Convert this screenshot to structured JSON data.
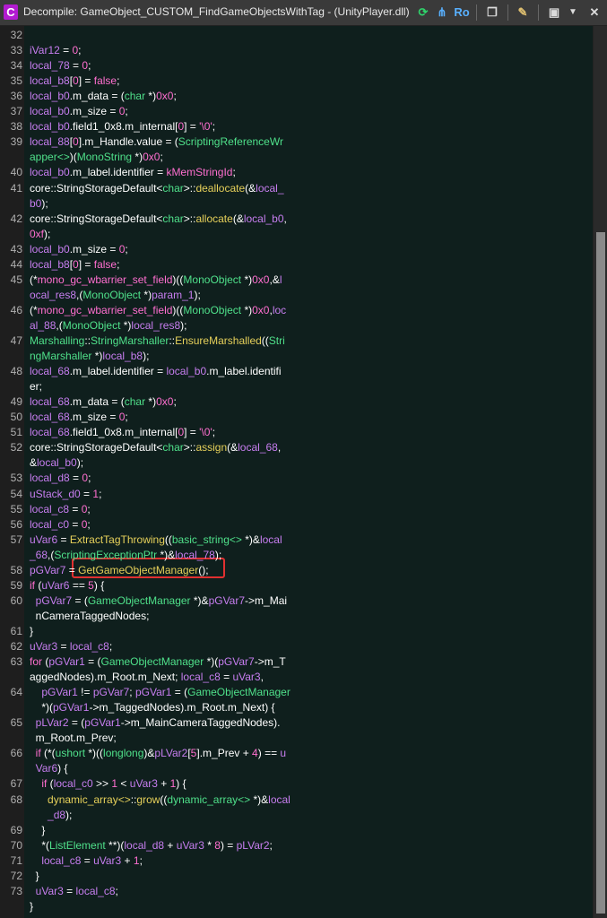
{
  "window": {
    "title": "Decompile: GameObject_CUSTOM_FindGameObjectsWithTag -  (UnityPlayer.dll)",
    "app_icon_letter": "C",
    "toolbar": {
      "refresh_icon": "refresh-icon",
      "graph_icon": "graph-icon",
      "ro_label": "Ro",
      "copy_icon": "copy-icon",
      "edit_icon": "edit-icon",
      "snapshot_icon": "snapshot-icon",
      "close_label": "✕"
    }
  },
  "gutter_numbers": [
    "32",
    "33",
    "34",
    "35",
    "36",
    "37",
    "38",
    "39",
    "40",
    "41",
    "42",
    "43",
    "44",
    "45",
    "46",
    "47",
    "48",
    "49",
    "50",
    "51",
    "52",
    "53",
    "54",
    "55",
    "56",
    "57",
    "58",
    "59",
    "60",
    "61",
    "62",
    "63",
    "64",
    "65",
    "66",
    "67",
    "68",
    "69",
    "70",
    "71",
    "72",
    "73"
  ],
  "highlight": {
    "text": "GetGameObjectManager();",
    "color": "#e03030"
  },
  "code_lines": [
    {
      "ln": "32",
      "html": ""
    },
    {
      "ln": "33",
      "html": "<span class='v'>iVar12</span> = <span class='n'>0</span>;"
    },
    {
      "ln": "34",
      "html": "<span class='v'>local_78</span> = <span class='n'>0</span>;"
    },
    {
      "ln": "35",
      "html": "<span class='v'>local_b8</span>[<span class='n'>0</span>] = <span class='n'>false</span>;"
    },
    {
      "ln": "36",
      "html": "<span class='v'>local_b0</span>.m_data = (<span class='t'>char</span> *)<span class='n'>0x0</span>;"
    },
    {
      "ln": "37",
      "html": "<span class='v'>local_b0</span>.m_size = <span class='n'>0</span>;"
    },
    {
      "ln": "38",
      "html": "<span class='v'>local_b0</span>.field1_0x8.m_internal[<span class='n'>0</span>] = <span class='n'>'\\0'</span>;"
    },
    {
      "ln": "39",
      "html": "<span class='v'>local_88</span>[<span class='n'>0</span>].m_Handle.value = (<span class='t'>ScriptingReferenceWr</span>"
    },
    {
      "ln": "",
      "html": "<span class='t'>apper&lt;&gt;</span>)(<span class='t'>MonoString</span> *)<span class='n'>0x0</span>;"
    },
    {
      "ln": "40",
      "html": "<span class='v'>local_b0</span>.m_label.identifier = <span class='n'>kMemStringId</span>;"
    },
    {
      "ln": "41",
      "html": "core::StringStorageDefault&lt;<span class='t'>char</span>&gt;::<span class='f'>deallocate</span>(&amp;<span class='v'>local_</span>"
    },
    {
      "ln": "",
      "html": "<span class='v'>b0</span>);"
    },
    {
      "ln": "42",
      "html": "core::StringStorageDefault&lt;<span class='t'>char</span>&gt;::<span class='f'>allocate</span>(&amp;<span class='v'>local_b0</span>,"
    },
    {
      "ln": "",
      "html": "<span class='n'>0xf</span>);"
    },
    {
      "ln": "43",
      "html": "<span class='v'>local_b0</span>.m_size = <span class='n'>0</span>;"
    },
    {
      "ln": "44",
      "html": "<span class='v'>local_b8</span>[<span class='n'>0</span>] = <span class='n'>false</span>;"
    },
    {
      "ln": "45",
      "html": "(*<span class='n'>mono_gc_wbarrier_set_field</span>)((<span class='t'>MonoObject</span> *)<span class='n'>0x0</span>,&amp;<span class='v'>l</span>"
    },
    {
      "ln": "",
      "html": "<span class='v'>ocal_res8</span>,(<span class='t'>MonoObject</span> *)<span class='v'>param_1</span>);"
    },
    {
      "ln": "46",
      "html": "(*<span class='n'>mono_gc_wbarrier_set_field</span>)((<span class='t'>MonoObject</span> *)<span class='n'>0x0</span>,<span class='v'>loc</span>"
    },
    {
      "ln": "",
      "html": "<span class='v'>al_88</span>,(<span class='t'>MonoObject</span> *)<span class='v'>local_res8</span>);"
    },
    {
      "ln": "47",
      "html": "<span class='t'>Marshalling</span>::<span class='t'>StringMarshaller</span>::<span class='f'>EnsureMarshalled</span>((<span class='t'>Stri</span>"
    },
    {
      "ln": "",
      "html": "<span class='t'>ngMarshaller</span> *)<span class='v'>local_b8</span>);"
    },
    {
      "ln": "48",
      "html": "<span class='v'>local_68</span>.m_label.identifier = <span class='v'>local_b0</span>.m_label.identifi"
    },
    {
      "ln": "",
      "html": "er;"
    },
    {
      "ln": "49",
      "html": "<span class='v'>local_68</span>.m_data = (<span class='t'>char</span> *)<span class='n'>0x0</span>;"
    },
    {
      "ln": "50",
      "html": "<span class='v'>local_68</span>.m_size = <span class='n'>0</span>;"
    },
    {
      "ln": "51",
      "html": "<span class='v'>local_68</span>.field1_0x8.m_internal[<span class='n'>0</span>] = <span class='n'>'\\0'</span>;"
    },
    {
      "ln": "52",
      "html": "core::StringStorageDefault&lt;<span class='t'>char</span>&gt;::<span class='f'>assign</span>(&amp;<span class='v'>local_68</span>,"
    },
    {
      "ln": "",
      "html": "&amp;<span class='v'>local_b0</span>);"
    },
    {
      "ln": "53",
      "html": "<span class='v'>local_d8</span> = <span class='n'>0</span>;"
    },
    {
      "ln": "54",
      "html": "<span class='v'>uStack_d0</span> = <span class='n'>1</span>;"
    },
    {
      "ln": "55",
      "html": "<span class='v'>local_c8</span> = <span class='n'>0</span>;"
    },
    {
      "ln": "56",
      "html": "<span class='v'>local_c0</span> = <span class='n'>0</span>;"
    },
    {
      "ln": "57",
      "html": "<span class='v'>uVar6</span> = <span class='f'>ExtractTagThrowing</span>((<span class='t'>basic_string&lt;&gt;</span> *)&amp;<span class='v'>local</span>"
    },
    {
      "ln": "",
      "html": "<span class='v'>_68</span>,(<span class='t'>ScriptingExceptionPtr</span> *)&amp;<span class='v'>local_78</span>);"
    },
    {
      "ln": "58",
      "html": "<span class='v'>pGVar7</span> = <span class='f'>GetGameObjectManager</span>();"
    },
    {
      "ln": "59",
      "html": "<span class='n'>if</span> (<span class='v'>uVar6</span> == <span class='n'>5</span>) {"
    },
    {
      "ln": "60",
      "html": "  <span class='v'>pGVar7</span> = (<span class='t'>GameObjectManager</span> *)&amp;<span class='v'>pGVar7</span>-&gt;m_Mai"
    },
    {
      "ln": "",
      "html": "  nCameraTaggedNodes;"
    },
    {
      "ln": "61",
      "html": "}"
    },
    {
      "ln": "62",
      "html": "<span class='v'>uVar3</span> = <span class='v'>local_c8</span>;"
    },
    {
      "ln": "63",
      "html": "<span class='n'>for</span> (<span class='v'>pGVar1</span> = (<span class='t'>GameObjectManager</span> *)(<span class='v'>pGVar7</span>-&gt;m_T"
    },
    {
      "ln": "",
      "html": "aggedNodes).m_Root.m_Next; <span class='v'>local_c8</span> = <span class='v'>uVar3</span>,"
    },
    {
      "ln": "64",
      "html": "    <span class='v'>pGVar1</span> != <span class='v'>pGVar7</span>; <span class='v'>pGVar1</span> = (<span class='t'>GameObjectManager</span>"
    },
    {
      "ln": "",
      "html": "    *)(<span class='v'>pGVar1</span>-&gt;m_TaggedNodes).m_Root.m_Next) {"
    },
    {
      "ln": "65",
      "html": "  <span class='v'>pLVar2</span> = (<span class='v'>pGVar1</span>-&gt;m_MainCameraTaggedNodes)."
    },
    {
      "ln": "",
      "html": "  m_Root.m_Prev;"
    },
    {
      "ln": "66",
      "html": "  <span class='n'>if</span> (*(<span class='t'>ushort</span> *)((<span class='t'>longlong</span>)&amp;<span class='v'>pLVar2</span>[<span class='n'>5</span>].m_Prev + <span class='n'>4</span>) == <span class='v'>u</span>"
    },
    {
      "ln": "",
      "html": "  <span class='v'>Var6</span>) {"
    },
    {
      "ln": "67",
      "html": "    <span class='n'>if</span> (<span class='v'>local_c0</span> &gt;&gt; <span class='n'>1</span> &lt; <span class='v'>uVar3</span> + <span class='n'>1</span>) {"
    },
    {
      "ln": "68",
      "html": "      <span class='f'>dynamic_array&lt;&gt;</span>::<span class='f'>grow</span>((<span class='t'>dynamic_array&lt;&gt;</span> *)&amp;<span class='v'>local</span>"
    },
    {
      "ln": "",
      "html": "      <span class='v'>_d8</span>);"
    },
    {
      "ln": "69",
      "html": "    }"
    },
    {
      "ln": "70",
      "html": "    *(<span class='t'>ListElement</span> **)(<span class='v'>local_d8</span> + <span class='v'>uVar3</span> * <span class='n'>8</span>) = <span class='v'>pLVar2</span>;"
    },
    {
      "ln": "71",
      "html": "    <span class='v'>local_c8</span> = <span class='v'>uVar3</span> + <span class='n'>1</span>;"
    },
    {
      "ln": "72",
      "html": "  }"
    },
    {
      "ln": "73",
      "html": "  <span class='v'>uVar3</span> = <span class='v'>local_c8</span>;"
    },
    {
      "ln": "",
      "html": "}"
    }
  ]
}
